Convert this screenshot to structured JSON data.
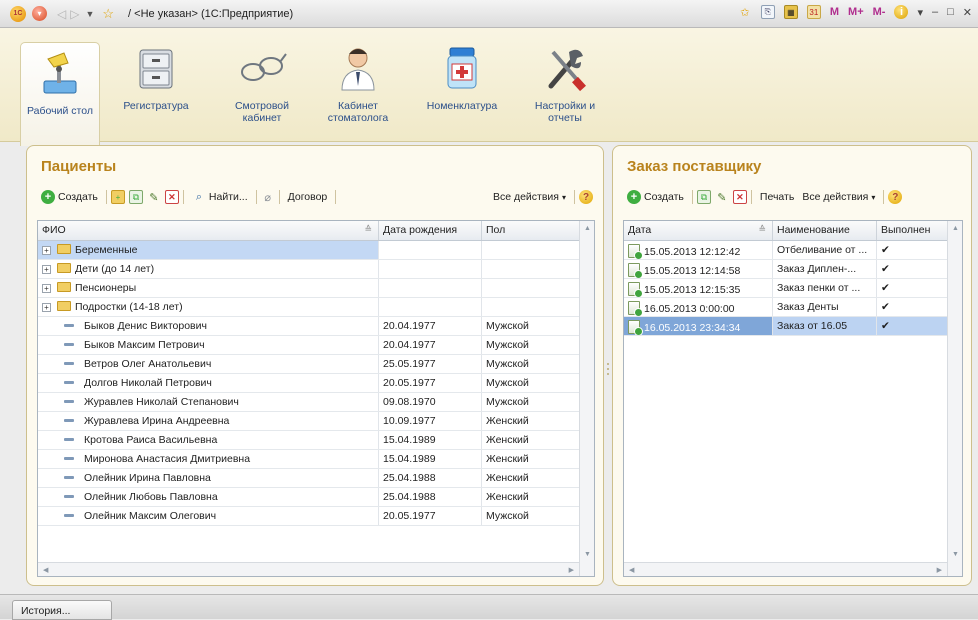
{
  "titlebar": {
    "title": "/ <Не указан>  (1С:Предприятие)",
    "logo_text": "1С",
    "m": "M",
    "m_plus": "M+",
    "m_minus": "M-"
  },
  "sections": [
    {
      "label": "Рабочий стол",
      "icon": "desk-lamp-icon"
    },
    {
      "label": "Регистратура",
      "icon": "file-cabinet-icon"
    },
    {
      "label": "Смотровой кабинет",
      "icon": "glasses-icon"
    },
    {
      "label": "Кабинет стоматолога",
      "icon": "doctor-icon"
    },
    {
      "label": "Номенклатура",
      "icon": "medicine-jar-icon"
    },
    {
      "label": "Настройки и отчеты",
      "icon": "tools-icon"
    }
  ],
  "patients": {
    "title": "Пациенты",
    "toolbar": {
      "create": "Создать",
      "find": "Найти...",
      "contract": "Договор",
      "all_actions": "Все действия"
    },
    "columns": [
      "ФИО",
      "Дата рождения",
      "Пол"
    ],
    "groups": [
      "Беременные",
      "Дети (до 14 лет)",
      "Пенсионеры",
      "Подростки (14-18 лет)"
    ],
    "rows": [
      {
        "name": "Быков Денис Викторович",
        "dob": "20.04.1977",
        "sex": "Мужской"
      },
      {
        "name": "Быков Максим Петрович",
        "dob": "20.04.1977",
        "sex": "Мужской"
      },
      {
        "name": "Ветров Олег Анатольевич",
        "dob": "25.05.1977",
        "sex": "Мужской"
      },
      {
        "name": "Долгов Николай Петрович",
        "dob": "20.05.1977",
        "sex": "Мужской"
      },
      {
        "name": "Журавлев Николай Степанович",
        "dob": "09.08.1970",
        "sex": "Мужской"
      },
      {
        "name": "Журавлева Ирина Андреевна",
        "dob": "10.09.1977",
        "sex": "Женский"
      },
      {
        "name": "Кротова Раиса Васильевна",
        "dob": "15.04.1989",
        "sex": "Женский"
      },
      {
        "name": "Миронова Анастасия Дмитриевна",
        "dob": "15.04.1989",
        "sex": "Женский"
      },
      {
        "name": "Олейник Ирина Павловна",
        "dob": "25.04.1988",
        "sex": "Женский"
      },
      {
        "name": "Олейник Любовь Павловна",
        "dob": "25.04.1988",
        "sex": "Женский"
      },
      {
        "name": "Олейник Максим Олегович",
        "dob": "20.05.1977",
        "sex": "Мужской"
      }
    ]
  },
  "orders": {
    "title": "Заказ поставщику",
    "toolbar": {
      "create": "Создать",
      "print": "Печать",
      "all_actions": "Все действия"
    },
    "columns": [
      "Дата",
      "Наименование",
      "Выполнен"
    ],
    "rows": [
      {
        "date": "15.05.2013 12:12:42",
        "name": "Отбеливание от ...",
        "done": "✔"
      },
      {
        "date": "15.05.2013 12:14:58",
        "name": "Заказ Диплен-...",
        "done": "✔"
      },
      {
        "date": "15.05.2013 12:15:35",
        "name": "Заказ пенки от ...",
        "done": "✔"
      },
      {
        "date": "16.05.2013 0:00:00",
        "name": "Заказ Денты",
        "done": "✔"
      },
      {
        "date": "16.05.2013 23:34:34",
        "name": "Заказ от 16.05",
        "done": "✔"
      }
    ]
  },
  "bottom": {
    "history": "История..."
  }
}
